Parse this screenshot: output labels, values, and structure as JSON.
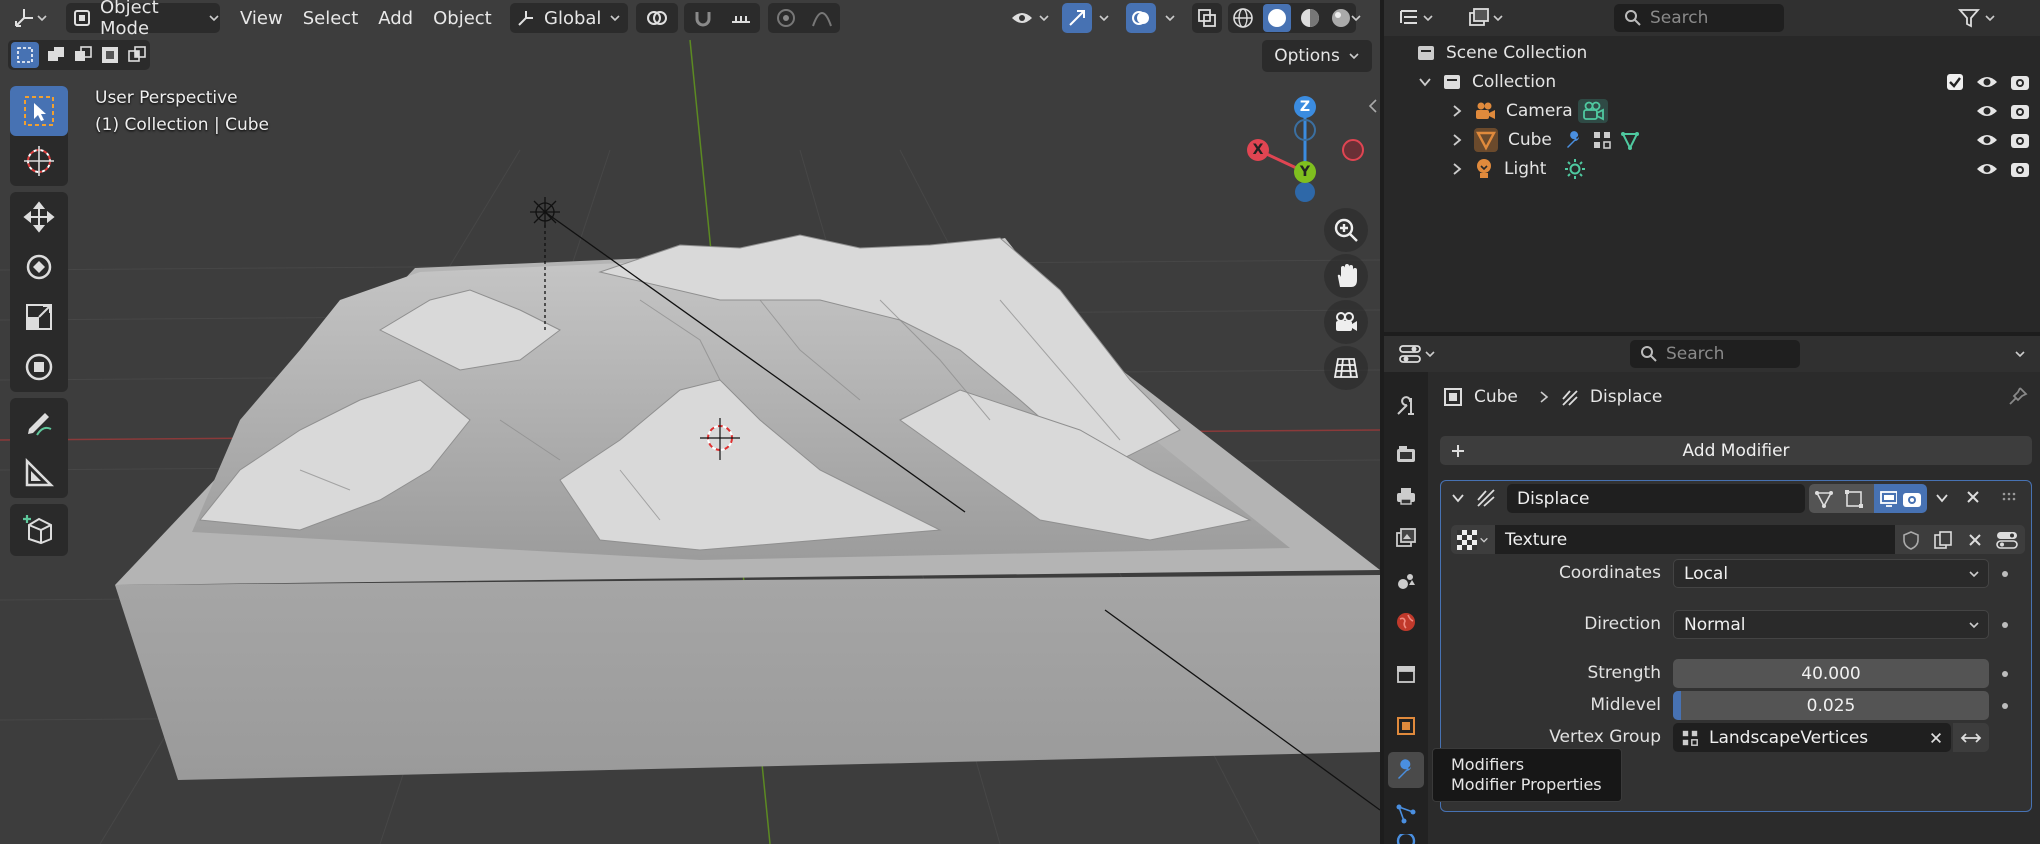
{
  "viewport": {
    "mode_label": "Object Mode",
    "menu": [
      "View",
      "Select",
      "Add",
      "Object"
    ],
    "transform_orientation": "Global",
    "options_label": "Options",
    "perspective_label": "User Perspective",
    "collection_label": "(1) Collection | Cube",
    "gizmo": {
      "z": "Z",
      "y": "Y",
      "x": "X"
    }
  },
  "outliner": {
    "search_placeholder": "Search",
    "items": {
      "scene_collection": "Scene Collection",
      "collection": "Collection",
      "camera": "Camera",
      "cube": "Cube",
      "light": "Light"
    }
  },
  "properties": {
    "search_placeholder": "Search",
    "breadcrumb": {
      "object": "Cube",
      "modifier": "Displace"
    },
    "add_modifier_label": "Add Modifier",
    "modifier": {
      "name": "Displace",
      "texture_name": "Texture",
      "coordinates_label": "Coordinates",
      "coordinates_value": "Local",
      "direction_label": "Direction",
      "direction_value": "Normal",
      "strength_label": "Strength",
      "strength_value": "40.000",
      "midlevel_label": "Midlevel",
      "midlevel_value": "0.025",
      "midlevel_fraction": 0.025,
      "vertex_group_label": "Vertex Group",
      "vertex_group_value": "LandscapeVertices"
    },
    "tooltip": {
      "title": "Modifiers",
      "subtitle": "Modifier Properties"
    }
  },
  "colors": {
    "accent": "#4772b3",
    "axis_x": "#e04552",
    "axis_y": "#7fbf1f",
    "axis_z": "#3b8ce0",
    "object_orange": "#e08a3c",
    "light_green": "#4fc9a0"
  }
}
